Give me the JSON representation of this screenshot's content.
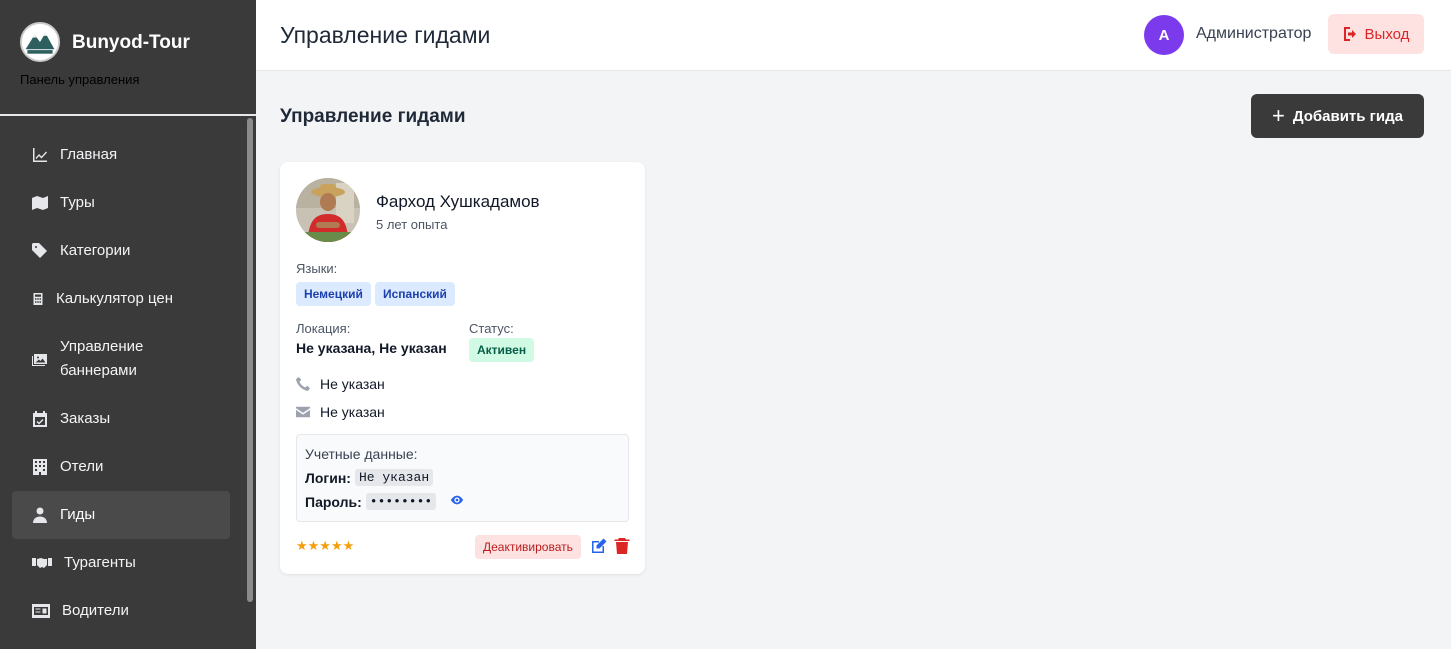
{
  "brand": {
    "name": "Bunyod-Tour",
    "subtitle": "Панель управления"
  },
  "sidebar": {
    "items": [
      {
        "label": "Главная",
        "icon": "chart-line-icon"
      },
      {
        "label": "Туры",
        "icon": "map-icon"
      },
      {
        "label": "Категории",
        "icon": "tags-icon"
      },
      {
        "label": "Калькулятор цен",
        "icon": "calculator-icon"
      },
      {
        "label": "Управление баннерами",
        "icon": "images-icon"
      },
      {
        "label": "Заказы",
        "icon": "calendar-check-icon"
      },
      {
        "label": "Отели",
        "icon": "building-icon"
      },
      {
        "label": "Гиды",
        "icon": "user-icon",
        "active": true
      },
      {
        "label": "Турагенты",
        "icon": "handshake-icon"
      },
      {
        "label": "Водители",
        "icon": "id-card-icon"
      }
    ]
  },
  "header": {
    "title": "Управление гидами",
    "avatar_letter": "A",
    "user_name": "Администратор",
    "logout_label": "Выход"
  },
  "main": {
    "section_title": "Управление гидами",
    "add_button_label": "Добавить гида"
  },
  "guide_card": {
    "name": "Фарход Хушкадамов",
    "experience": "5 лет опыта",
    "languages_label": "Языки:",
    "languages": [
      "Немецкий",
      "Испанский"
    ],
    "location_label": "Локация:",
    "location_value": "Не указана, Не указан",
    "status_label": "Статус:",
    "status_value": "Активен",
    "phone": "Не указан",
    "email": "Не указан",
    "credentials_title": "Учетные данные:",
    "login_label": "Логин:",
    "login_value": "Не указан",
    "password_label": "Пароль:",
    "password_value": "••••••••",
    "rating": "★★★★★",
    "rating_value": 5,
    "deactivate_label": "Деактивировать"
  },
  "colors": {
    "sidebar_bg": "#3a3a3a",
    "accent_avatar": "#7c3aed",
    "logout_text": "#dc2626",
    "lang_tag_bg": "#dbeafe",
    "status_tag_bg": "#d1fae5",
    "star": "#f59e0b"
  }
}
